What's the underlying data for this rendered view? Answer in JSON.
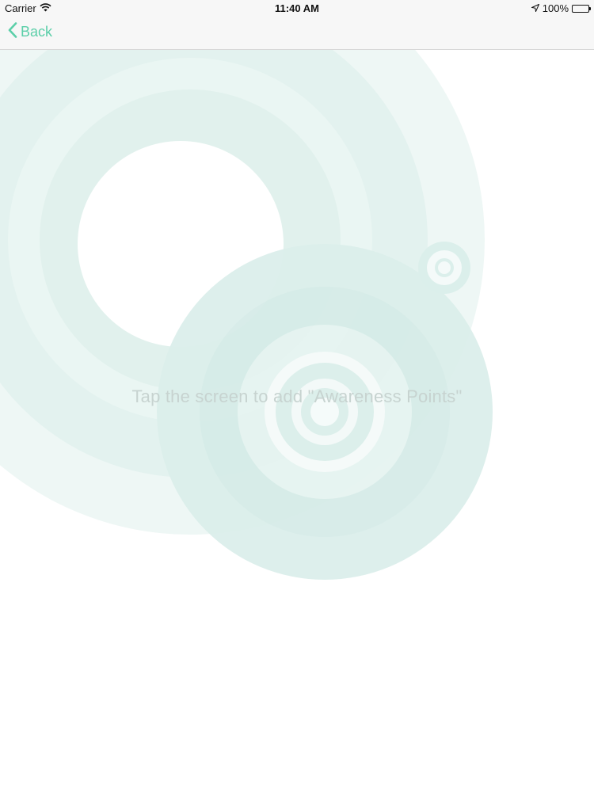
{
  "status_bar": {
    "carrier": "Carrier",
    "time": "11:40 AM",
    "battery": "100%",
    "icons": [
      "wifi-icon",
      "location-arrow-icon",
      "battery-icon"
    ]
  },
  "nav": {
    "back_label": "Back",
    "icons": [
      "chevron-left-icon"
    ]
  },
  "main": {
    "instruction": "Tap the screen to add \"Awareness Points\""
  },
  "colors": {
    "accent": "#5ccfa9",
    "ripple": "#d6eeea"
  }
}
